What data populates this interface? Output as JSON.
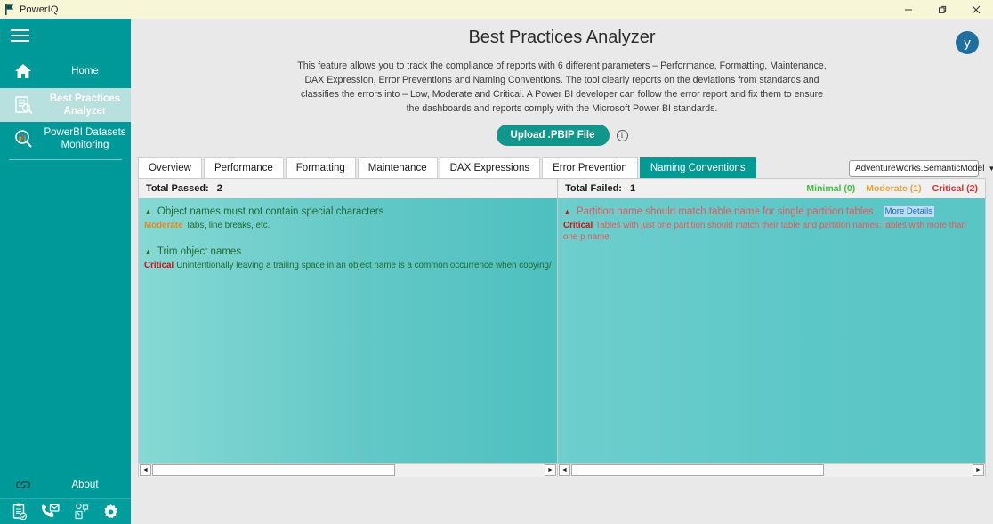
{
  "window": {
    "title": "PowerIQ",
    "app_icon": "flag-icon",
    "controls": {
      "minimize": "—",
      "restore": "❐",
      "close": "✕"
    }
  },
  "theme": {
    "sidebar_bg": "#009999",
    "accent": "#11968c",
    "tab_active_bg": "#029a94",
    "panel_gradient_start": "#86d9d4",
    "panel_gradient_end": "#4ec0c0",
    "severity_minimal": "#3fc13f",
    "severity_moderate": "#e8a33d",
    "severity_critical": "#e03131",
    "avatar_bg": "#1f6fa0"
  },
  "sidebar": {
    "menu_icon": "hamburger-icon",
    "items": [
      {
        "label": "Home",
        "icon": "home-icon",
        "active": false
      },
      {
        "label": "Best Practices Analyzer",
        "icon": "report-analysis-icon",
        "active": true
      },
      {
        "label": "PowerBI Datasets Monitoring",
        "icon": "magnifier-chart-icon",
        "active": false
      }
    ],
    "about": {
      "label": "About",
      "icon": "link-icon"
    },
    "bottom_icons": [
      {
        "name": "clipboard-check-icon"
      },
      {
        "name": "phone-mail-icon"
      },
      {
        "name": "support-chat-icon"
      },
      {
        "name": "gear-icon"
      }
    ]
  },
  "header": {
    "title": "Best Practices Analyzer",
    "description": "This feature allows you to track the compliance of reports with 6 different parameters – Performance, Formatting, Maintenance, DAX Expression, Error Preventions and Naming Conventions. The tool clearly reports on the deviations from standards and classifies the errors into – Low, Moderate and Critical. A Power BI developer can follow the error report and fix them to ensure the dashboards and reports comply with the Microsoft Power BI standards.",
    "upload_button": "Upload .PBIP File",
    "info_icon": "info-circle-icon",
    "avatar_initial": "y"
  },
  "tabs": [
    {
      "label": "Overview",
      "active": false
    },
    {
      "label": "Performance",
      "active": false
    },
    {
      "label": "Formatting",
      "active": false
    },
    {
      "label": "Maintenance",
      "active": false
    },
    {
      "label": "DAX Expressions",
      "active": false
    },
    {
      "label": "Error Prevention",
      "active": false
    },
    {
      "label": "Naming Conventions",
      "active": true
    }
  ],
  "model_select": {
    "value": "AdventureWorks.SemanticModel",
    "caret": "▼"
  },
  "passed_panel": {
    "header": "Total Passed:",
    "count": "2",
    "rules": [
      {
        "title": "Object names must not contain special characters",
        "severity": "Moderate",
        "description": "Tabs, line breaks, etc."
      },
      {
        "title": "Trim object names",
        "severity": "Critical",
        "description": "Unintentionally leaving a trailing space in an object name is a common occurrence when copying/duplic"
      }
    ]
  },
  "failed_panel": {
    "header": "Total Failed:",
    "count": "1",
    "legend": {
      "minimal": "Minimal (0)",
      "moderate": "Moderate (1)",
      "critical": "Critical (2)"
    },
    "rules": [
      {
        "title": "Partition name should match table name for single partition tables",
        "more_details": "More Details",
        "severity": "Critical",
        "description": "Tables with just one partition should match their table and partition names.Tables with more than one p name."
      }
    ]
  },
  "scrollbars": {
    "left_arrow": "◄",
    "right_arrow": "►"
  }
}
